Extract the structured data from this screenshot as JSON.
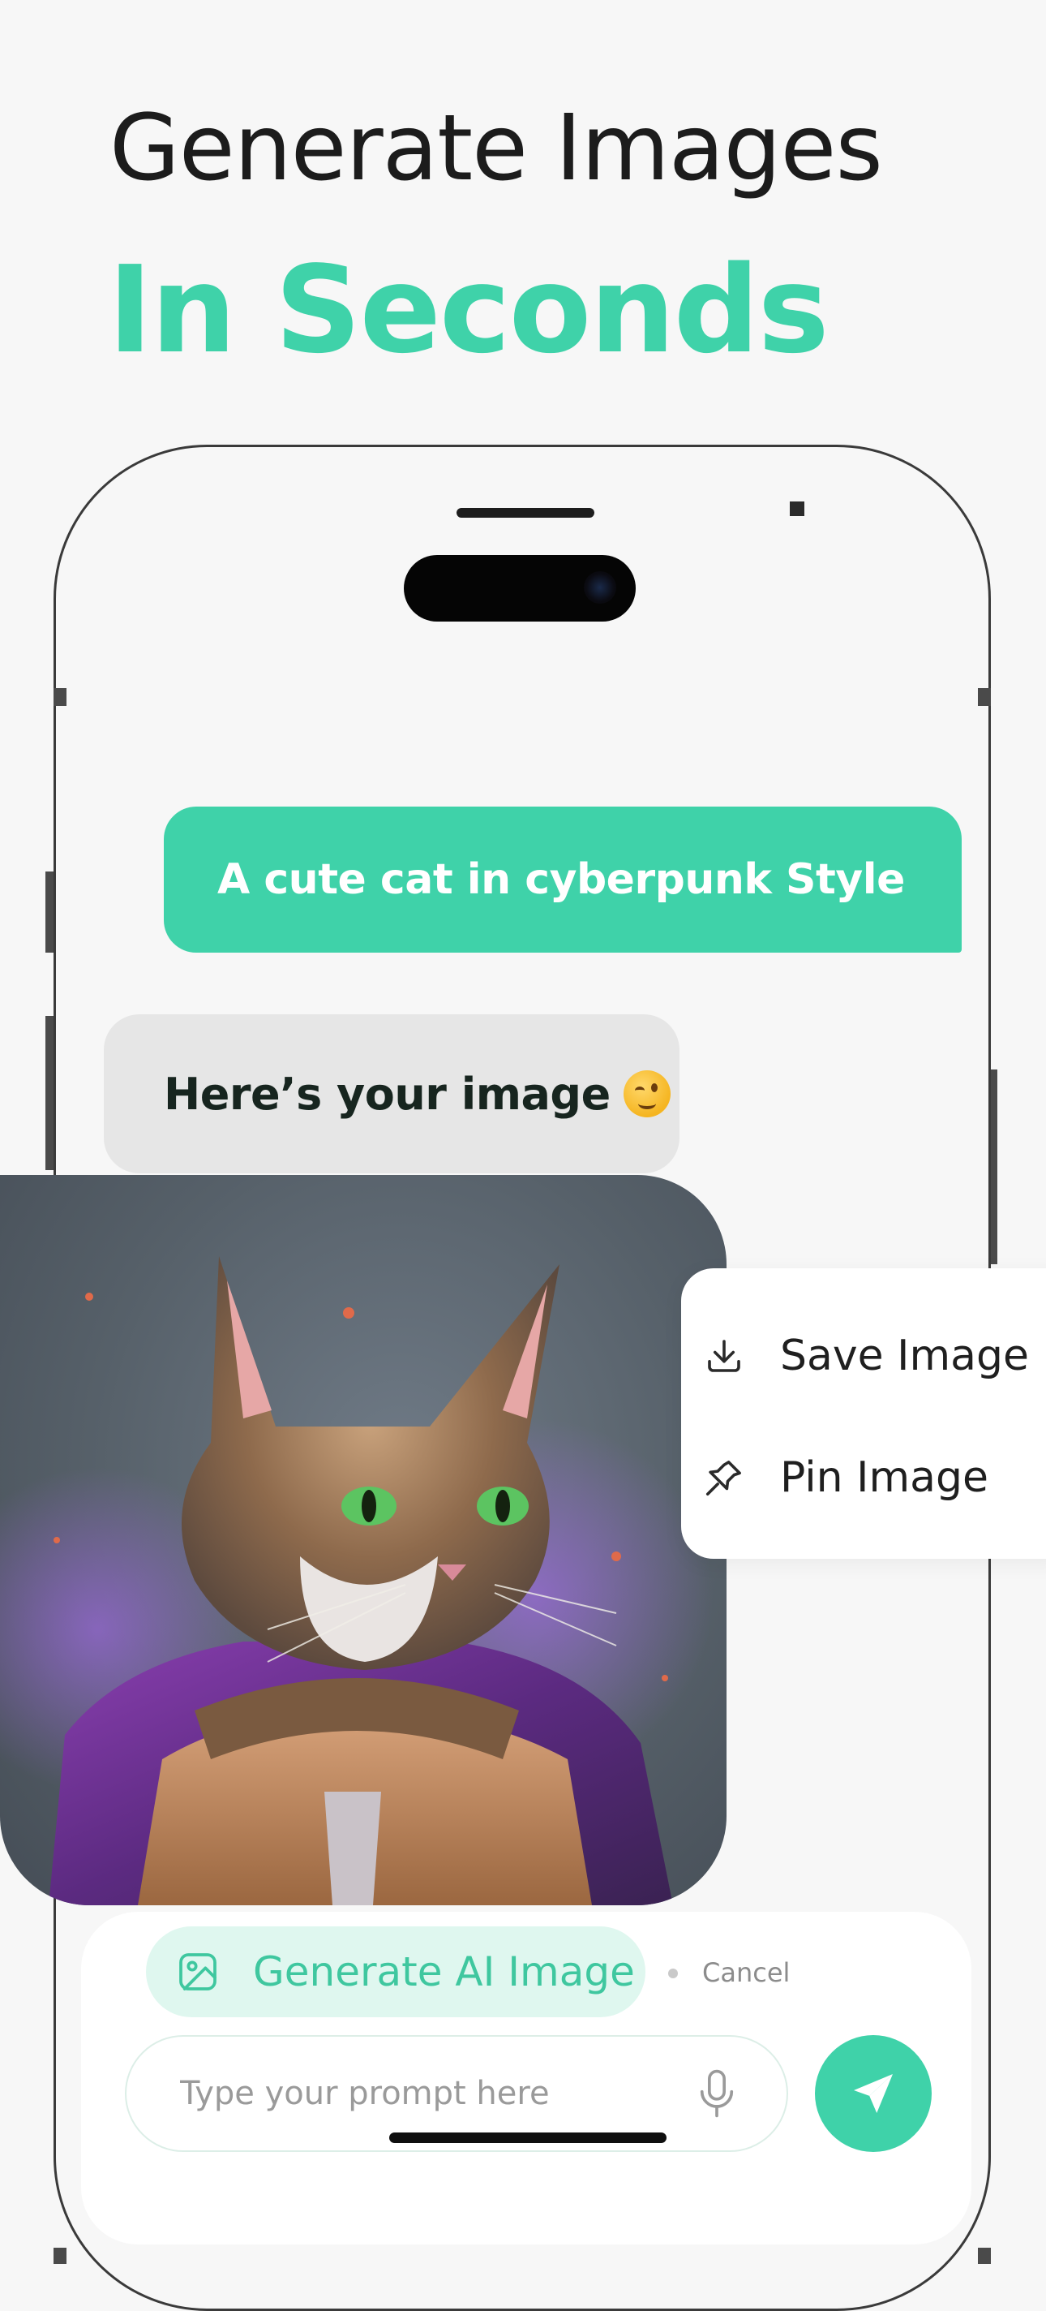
{
  "header": {
    "line1": "Generate Images",
    "line2": "In Seconds"
  },
  "chat": {
    "user_message": "A cute cat in cyberpunk Style",
    "bot_message": "Here’s your image",
    "bot_emoji": "winking-face-icon"
  },
  "context_menu": {
    "items": [
      {
        "label": "Save Image",
        "icon": "download-icon"
      },
      {
        "label": "Pin Image",
        "icon": "pin-icon"
      }
    ]
  },
  "composer": {
    "generate_label": "Generate AI Image",
    "cancel_label": "Cancel",
    "input_placeholder": "Type your prompt here",
    "input_value": ""
  },
  "colors": {
    "accent": "#3fd2a9",
    "accent_soft": "#dff7ef",
    "background": "#f7f7f7",
    "bot_bubble": "#e6e6e6"
  }
}
